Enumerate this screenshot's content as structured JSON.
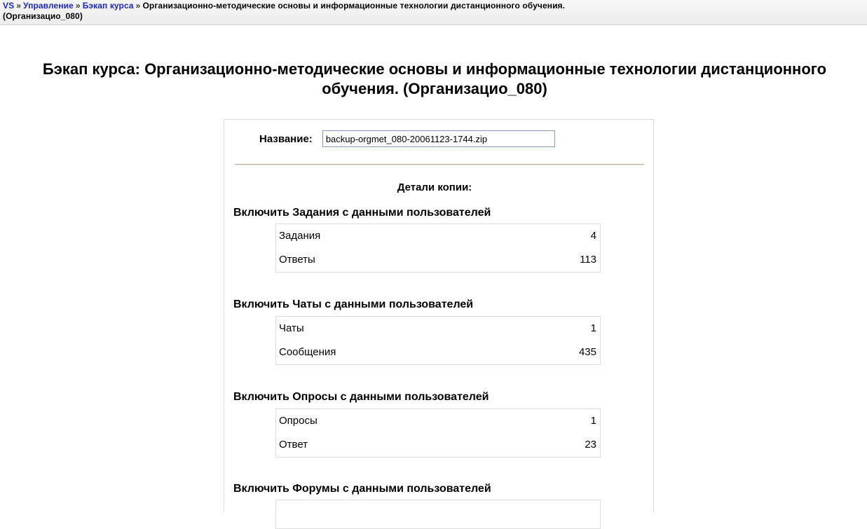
{
  "breadcrumb": {
    "items": [
      {
        "label": "VS",
        "link": true
      },
      {
        "label": "Управление",
        "link": true
      },
      {
        "label": "Бэкап курса",
        "link": true
      }
    ],
    "separator": "»",
    "current_line1": "Организационно-методические основы и информационные технологии дистанционного обучения.",
    "current_line2": "(Организацио_080)"
  },
  "page": {
    "title": "Бэкап курса: Организационно-методические основы и информационные технологии дистанционного обучения. (Организацио_080)"
  },
  "form": {
    "name_label": "Название:",
    "name_value": "backup-orgmet_080-20061123-1744.zip",
    "details_heading": "Детали копии:"
  },
  "sections": [
    {
      "heading": "Включить Задания с данными пользователей",
      "rows": [
        {
          "label": "Задания",
          "value": "4"
        },
        {
          "label": "Ответы",
          "value": "113"
        }
      ]
    },
    {
      "heading": "Включить Чаты с данными пользователей",
      "rows": [
        {
          "label": "Чаты",
          "value": "1"
        },
        {
          "label": "Сообщения",
          "value": "435"
        }
      ]
    },
    {
      "heading": "Включить Опросы с данными пользователей",
      "rows": [
        {
          "label": "Опросы",
          "value": "1"
        },
        {
          "label": "Ответ",
          "value": "23"
        }
      ]
    },
    {
      "heading": "Включить Форумы с данными пользователей",
      "rows": []
    }
  ]
}
